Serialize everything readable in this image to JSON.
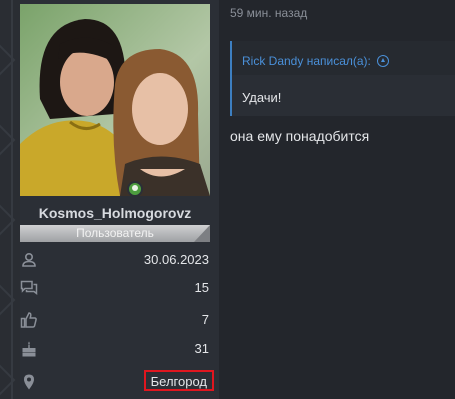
{
  "post": {
    "time": "59 мин. назад",
    "quote": {
      "author_line": "Rick Dandy написал(а):",
      "text": "Удачи!"
    },
    "message": "она ему понадобится"
  },
  "user": {
    "username": "Kosmos_Holmogorovz",
    "role": "Пользователь",
    "online": true,
    "stats": [
      {
        "icon": "person-icon",
        "value": "30.06.2023"
      },
      {
        "icon": "messages-icon",
        "value": "15"
      },
      {
        "icon": "thumbs-up-icon",
        "value": "7"
      },
      {
        "icon": "cake-icon",
        "value": "31"
      },
      {
        "icon": "location-pin-icon",
        "value": "Белгород"
      }
    ]
  },
  "colors": {
    "background": "#23262c",
    "card": "#2b2f36",
    "accent": "#4a90d9",
    "online": "#4c9d3f",
    "highlight_box": "#e0161f"
  }
}
